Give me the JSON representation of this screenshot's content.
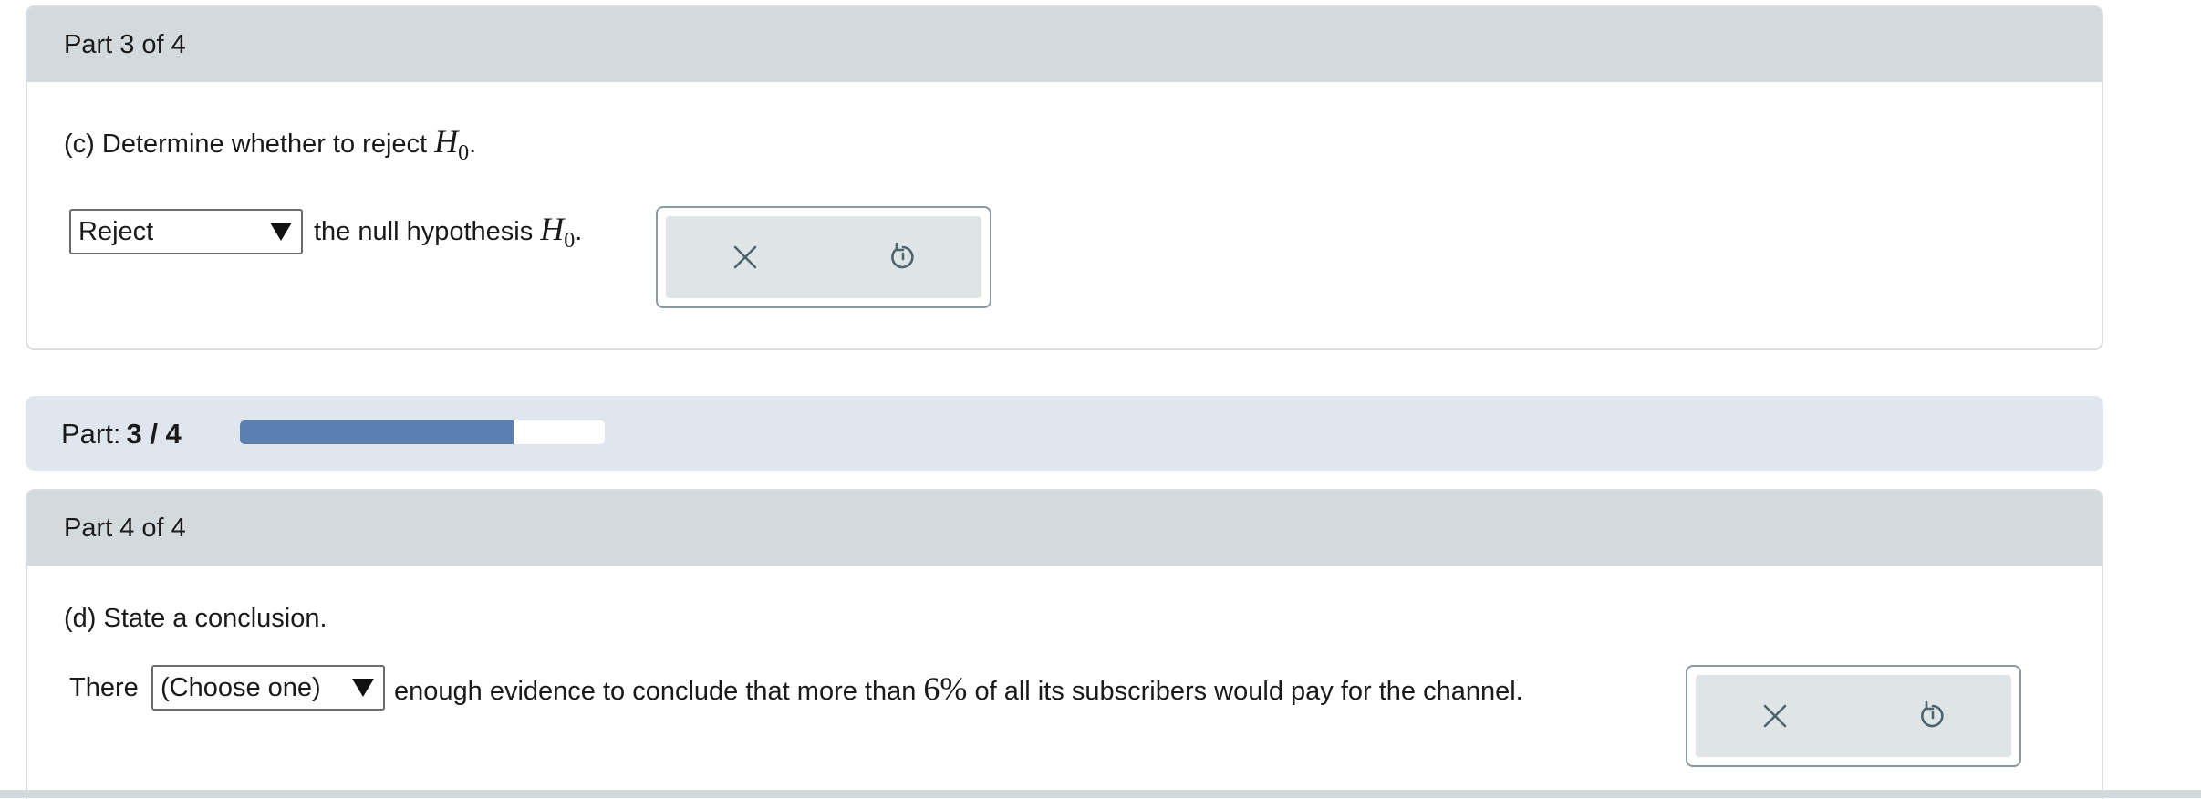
{
  "part3": {
    "header": "Part 3 of 4",
    "question_prefix": "(c) Determine whether to reject",
    "math_var": "H",
    "math_sub": "0",
    "period": ".",
    "select_value": "Reject",
    "after_select": "the null hypothesis"
  },
  "progress": {
    "label": "Part:",
    "value": "3 / 4",
    "fraction": 0.75,
    "fill_color": "#5b7fb0"
  },
  "part4": {
    "header": "Part 4 of 4",
    "question": "(d) State a conclusion.",
    "before_select": "There",
    "select_value": "(Choose one)",
    "after_select": "enough evidence to conclude that more than",
    "percent_number": "6",
    "percent_sign": "%",
    "tail": "of all its subscribers would pay for the channel."
  },
  "tools": {
    "clear_icon": "close-icon",
    "reset_icon": "undo-icon"
  }
}
